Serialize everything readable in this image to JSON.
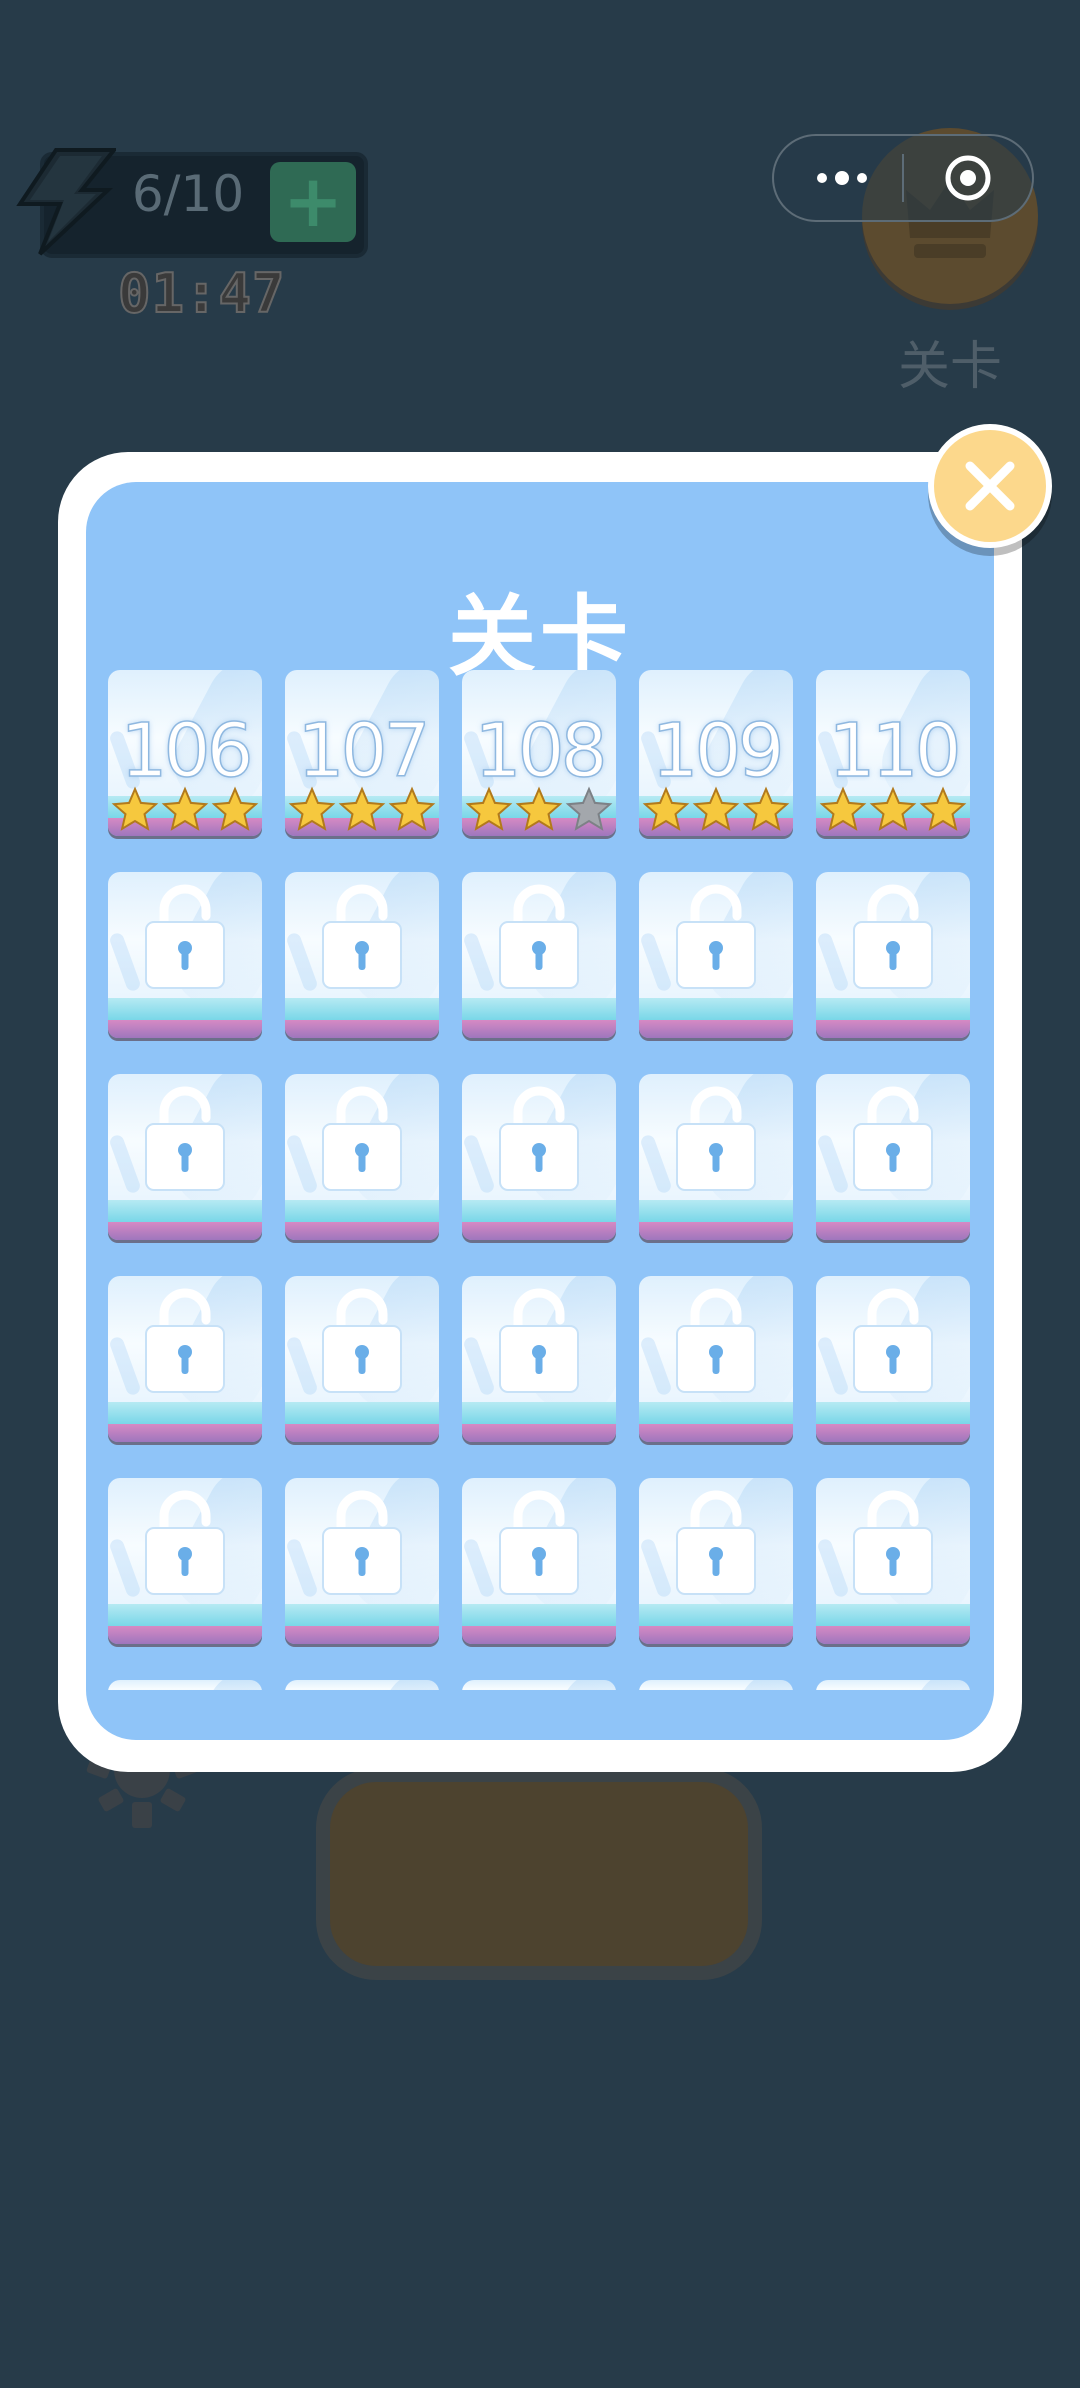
{
  "hud": {
    "energy": "6/10",
    "energy_add": "+",
    "timer": "01:47",
    "levels_button_label": "关卡"
  },
  "modal": {
    "title": "关卡",
    "unlocked_levels": [
      {
        "number": "106",
        "stars": 3
      },
      {
        "number": "107",
        "stars": 3
      },
      {
        "number": "108",
        "stars": 2
      },
      {
        "number": "109",
        "stars": 3
      },
      {
        "number": "110",
        "stars": 3
      }
    ],
    "locked_rows_visible": 4,
    "columns": 5
  },
  "colors": {
    "background": "#273b49",
    "panel": "#8fc4f8",
    "star_filled": "#f6c83e",
    "star_empty": "#a3a7ac",
    "close_button": "#fcd88c"
  },
  "icons": {
    "energy": "lightning-bolt-icon",
    "more": "more-dots-icon",
    "target": "target-icon",
    "crown": "crown-icon",
    "settings": "gear-icon",
    "close": "close-icon",
    "lock": "lock-icon",
    "star": "star-icon"
  }
}
